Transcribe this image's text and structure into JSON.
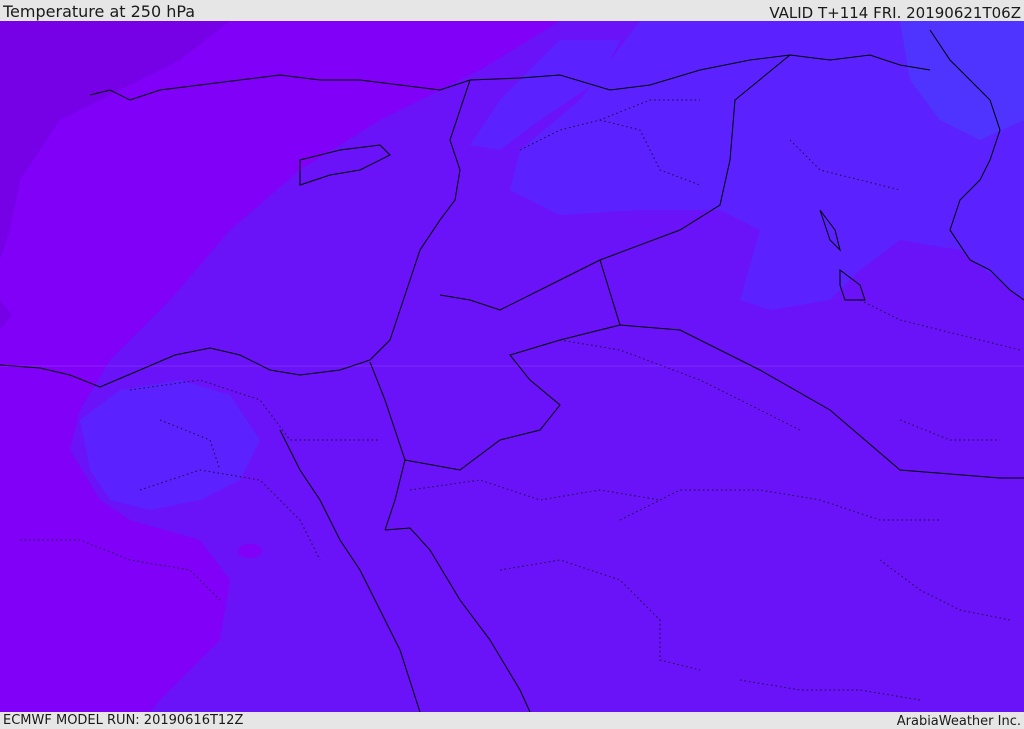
{
  "header": {
    "title": "Temperature at 250 hPa",
    "valid": "VALID T+114 FRI. 20190621T06Z"
  },
  "footer": {
    "model_run": "ECMWF MODEL RUN: 20190616T12Z",
    "credit": "ArabiaWeather Inc."
  },
  "colors": {
    "coldest": "#7600e6",
    "cold": "#8000f8",
    "mid": "#6a12f8",
    "warm": "#5b22ff",
    "warmest": "#4f34ff",
    "border": "#000000"
  }
}
